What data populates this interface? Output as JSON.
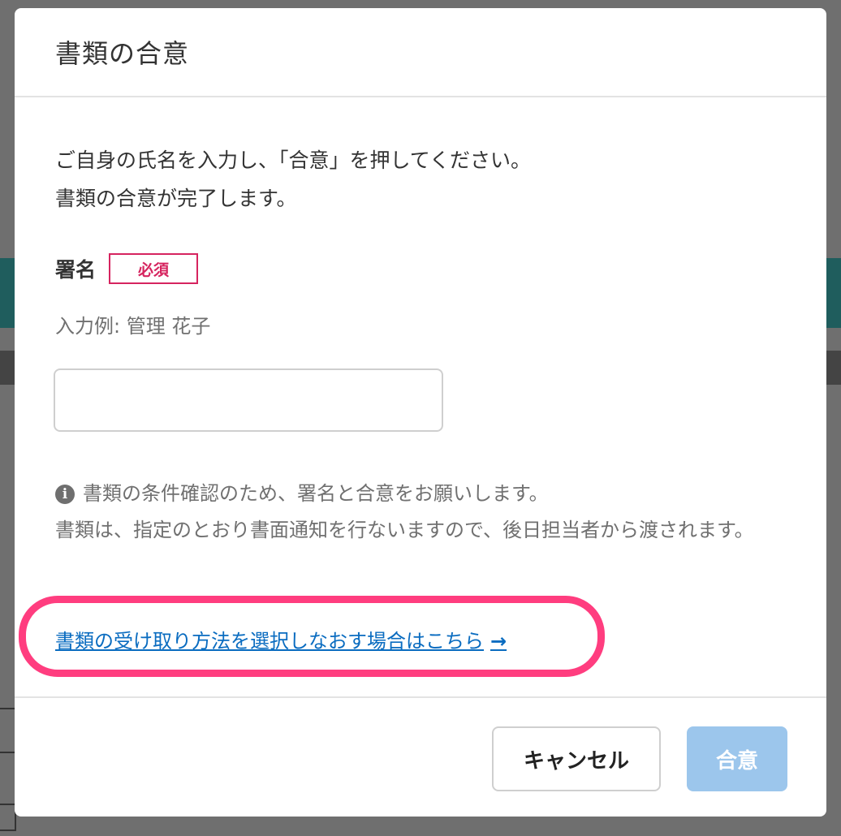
{
  "modal": {
    "title": "書類の合意",
    "intro_line1": "ご自身の氏名を入力し、「合意」を押してください。",
    "intro_line2": "書類の合意が完了します。",
    "signature_label": "署名",
    "required_badge": "必須",
    "example": "入力例: 管理 花子",
    "signature_value": "",
    "note_line1": "書類の条件確認のため、署名と合意をお願いします。",
    "note_line2": "書類は、指定のとおり書面通知を行ないますので、後日担当者から渡されます。",
    "link_text": "書類の受け取り方法を選択しなおす場合はこちら",
    "link_arrow": "→",
    "cancel_label": "キャンセル",
    "agree_label": "合意"
  },
  "colors": {
    "accent_pink": "#d6245f",
    "highlight_ring": "#ff3d7f",
    "link_blue": "#0a6cc0",
    "agree_disabled": "#9cc6ec"
  }
}
